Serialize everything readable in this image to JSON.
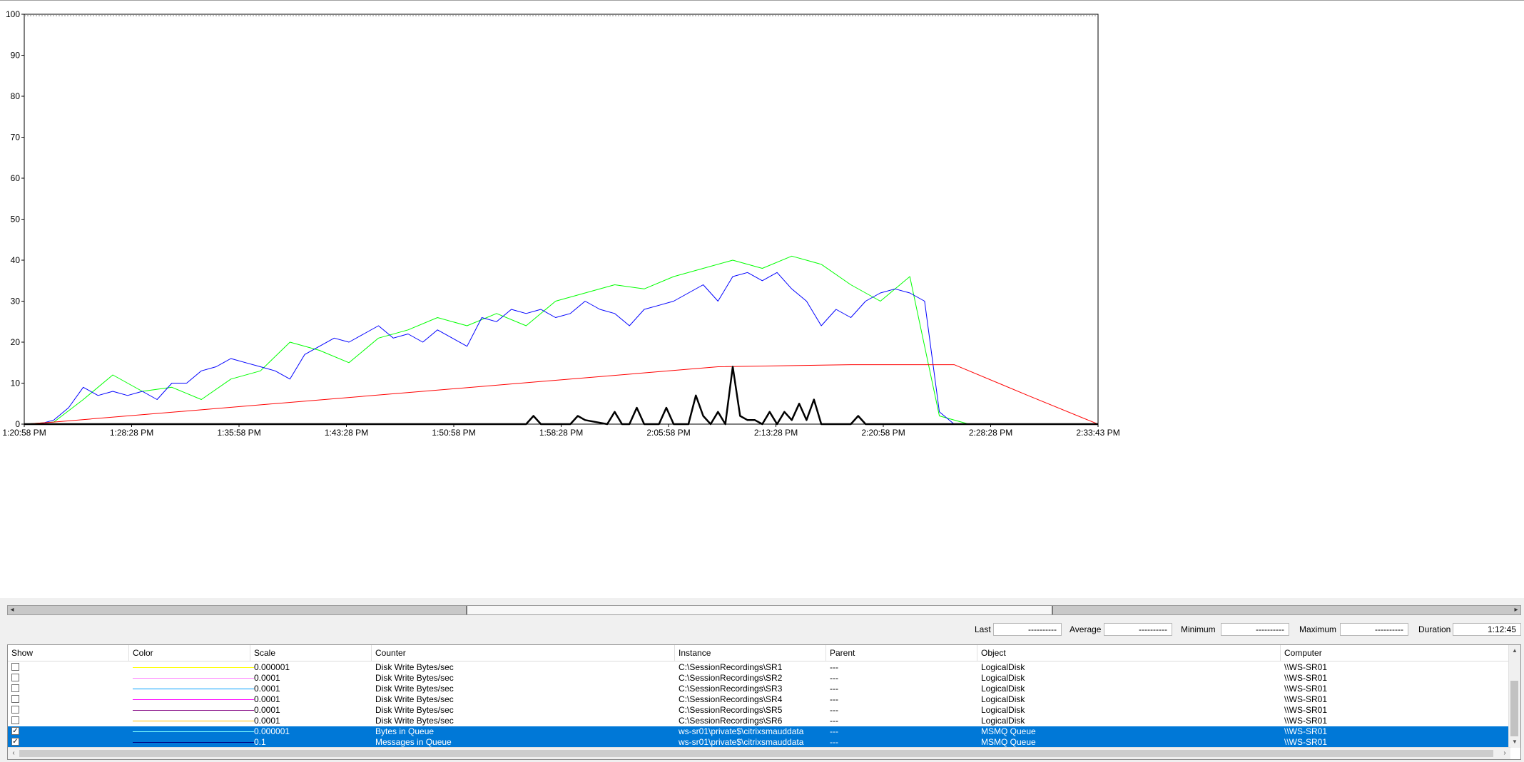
{
  "chart_data": {
    "type": "line",
    "ylim": [
      0,
      100
    ],
    "yticks": [
      "0",
      "10",
      "20",
      "30",
      "40",
      "50",
      "60",
      "70",
      "80",
      "90",
      "100"
    ],
    "xticks": [
      "1:20:58 PM",
      "1:28:28 PM",
      "1:35:58 PM",
      "1:43:28 PM",
      "1:50:58 PM",
      "1:58:28 PM",
      "2:05:58 PM",
      "2:13:28 PM",
      "2:20:58 PM",
      "2:28:28 PM",
      "2:33:43 PM"
    ],
    "xlim_minutes": [
      0,
      72.75
    ],
    "colors": {
      "green": "#00ff00",
      "blue": "#0000ff",
      "red": "#ff0000",
      "black": "#000000"
    },
    "series": [
      {
        "color": "#00ff00",
        "x": [
          0,
          2,
          4,
          6,
          8,
          10,
          12,
          14,
          16,
          18,
          20,
          22,
          24,
          26,
          28,
          30,
          32,
          34,
          36,
          38,
          40,
          42,
          44,
          46,
          48,
          50,
          52,
          54,
          56,
          58,
          60,
          62,
          64,
          66,
          68,
          70,
          72.75
        ],
        "values": [
          0,
          0.5,
          6,
          12,
          8,
          9,
          6,
          11,
          13,
          20,
          18,
          15,
          21,
          23,
          26,
          24,
          27,
          24,
          30,
          32,
          34,
          33,
          36,
          38,
          40,
          38,
          41,
          39,
          34,
          30,
          36,
          2,
          0,
          0,
          0,
          0,
          0
        ]
      },
      {
        "color": "#0000ff",
        "x": [
          0,
          1,
          2,
          3,
          4,
          5,
          6,
          7,
          8,
          9,
          10,
          11,
          12,
          13,
          14,
          15,
          16,
          17,
          18,
          19,
          20,
          21,
          22,
          23,
          24,
          25,
          26,
          27,
          28,
          29,
          30,
          31,
          32,
          33,
          34,
          35,
          36,
          37,
          38,
          39,
          40,
          41,
          42,
          43,
          44,
          45,
          46,
          47,
          48,
          49,
          50,
          51,
          52,
          53,
          54,
          55,
          56,
          57,
          58,
          59,
          60,
          61,
          62,
          63,
          64,
          65,
          66,
          68,
          70,
          72.75
        ],
        "values": [
          0,
          0,
          1,
          4,
          9,
          7,
          8,
          7,
          8,
          6,
          10,
          10,
          13,
          14,
          16,
          15,
          14,
          13,
          11,
          17,
          19,
          21,
          20,
          22,
          24,
          21,
          22,
          20,
          23,
          21,
          19,
          26,
          25,
          28,
          27,
          28,
          26,
          27,
          30,
          28,
          27,
          24,
          28,
          29,
          30,
          32,
          34,
          30,
          36,
          37,
          35,
          37,
          33,
          30,
          24,
          28,
          26,
          30,
          32,
          33,
          32,
          30,
          3,
          0,
          0,
          0,
          0,
          0,
          0,
          0
        ]
      },
      {
        "color": "#ff0000",
        "x": [
          0,
          2,
          47,
          56,
          57,
          60,
          63,
          66,
          68,
          72.75
        ],
        "values": [
          0,
          0.5,
          14,
          14.5,
          14.5,
          14.5,
          14.5,
          10,
          7,
          0
        ]
      },
      {
        "color": "#000000",
        "x": [
          0,
          34,
          34.5,
          35,
          37,
          37.5,
          38,
          39.5,
          40,
          40.5,
          41,
          41.5,
          42,
          43,
          43.5,
          44,
          45,
          45.5,
          46,
          46.5,
          47,
          47.5,
          48,
          48.5,
          49,
          49.5,
          50,
          50.5,
          51,
          51.5,
          52,
          52.5,
          53,
          53.5,
          54,
          54.5,
          55,
          56,
          56.5,
          57,
          72.75
        ],
        "values": [
          0,
          0,
          2,
          0,
          0,
          2,
          1,
          0,
          3,
          0,
          0,
          4,
          0,
          0,
          4,
          0,
          0,
          7,
          2,
          0,
          3,
          0,
          14,
          2,
          1,
          1,
          0,
          3,
          0,
          3,
          1,
          5,
          1,
          6,
          0,
          0,
          0,
          0,
          2,
          0,
          0
        ]
      }
    ]
  },
  "stats": {
    "last_label": "Last",
    "last_value": "----------",
    "average_label": "Average",
    "average_value": "----------",
    "minimum_label": "Minimum",
    "minimum_value": "----------",
    "maximum_label": "Maximum",
    "maximum_value": "----------",
    "duration_label": "Duration",
    "duration_value": "1:12:45"
  },
  "counter_list": {
    "columns": [
      "Show",
      "Color",
      "Scale",
      "Counter",
      "Instance",
      "Parent",
      "Object",
      "Computer"
    ],
    "rows": [
      {
        "show": false,
        "color": "#ffff00",
        "scale": "0.000001",
        "counter": "Disk Write Bytes/sec",
        "instance": "C:\\SessionRecordings\\SR1",
        "parent": "---",
        "object": "LogicalDisk",
        "computer": "\\\\WS-SR01",
        "selected": false
      },
      {
        "show": false,
        "color": "#ff80ff",
        "scale": "0.0001",
        "counter": "Disk Write Bytes/sec",
        "instance": "C:\\SessionRecordings\\SR2",
        "parent": "---",
        "object": "LogicalDisk",
        "computer": "\\\\WS-SR01",
        "selected": false
      },
      {
        "show": false,
        "color": "#00a0ff",
        "scale": "0.0001",
        "counter": "Disk Write Bytes/sec",
        "instance": "C:\\SessionRecordings\\SR3",
        "parent": "---",
        "object": "LogicalDisk",
        "computer": "\\\\WS-SR01",
        "selected": false
      },
      {
        "show": false,
        "color": "#ff00ff",
        "scale": "0.0001",
        "counter": "Disk Write Bytes/sec",
        "instance": "C:\\SessionRecordings\\SR4",
        "parent": "---",
        "object": "LogicalDisk",
        "computer": "\\\\WS-SR01",
        "selected": false
      },
      {
        "show": false,
        "color": "#800080",
        "scale": "0.0001",
        "counter": "Disk Write Bytes/sec",
        "instance": "C:\\SessionRecordings\\SR5",
        "parent": "---",
        "object": "LogicalDisk",
        "computer": "\\\\WS-SR01",
        "selected": false
      },
      {
        "show": false,
        "color": "#ffc000",
        "scale": "0.0001",
        "counter": "Disk Write Bytes/sec",
        "instance": "C:\\SessionRecordings\\SR6",
        "parent": "---",
        "object": "LogicalDisk",
        "computer": "\\\\WS-SR01",
        "selected": false
      },
      {
        "show": true,
        "color": "#80ffff",
        "scale": "0.000001",
        "counter": "Bytes in Queue",
        "instance": "ws-sr01\\private$\\citrixsmauddata",
        "parent": "---",
        "object": "MSMQ Queue",
        "computer": "\\\\WS-SR01",
        "selected": true
      },
      {
        "show": true,
        "color": "#000080",
        "scale": "0.1",
        "counter": "Messages in Queue",
        "instance": "ws-sr01\\private$\\citrixsmauddata",
        "parent": "---",
        "object": "MSMQ Queue",
        "computer": "\\\\WS-SR01",
        "selected": true
      }
    ]
  }
}
